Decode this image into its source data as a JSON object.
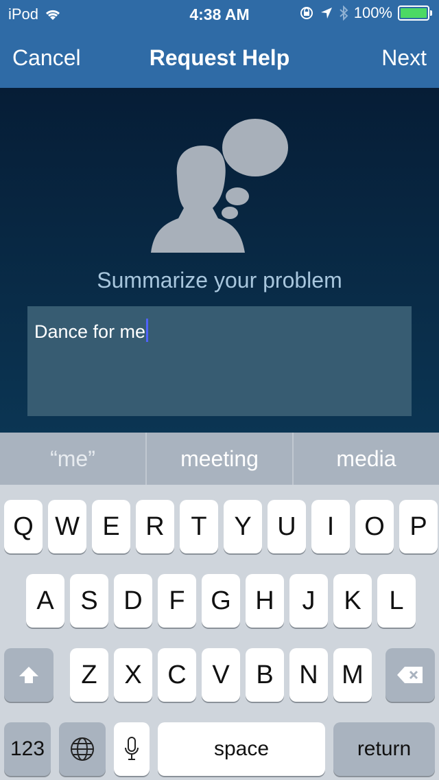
{
  "status_bar": {
    "carrier": "iPod",
    "time": "4:38 AM",
    "battery": "100%",
    "battery_level": 1.0
  },
  "nav": {
    "cancel": "Cancel",
    "title": "Request Help",
    "next": "Next"
  },
  "content": {
    "prompt": "Summarize your problem",
    "text_value": "Dance for me"
  },
  "keyboard": {
    "suggestions": [
      "“me”",
      "meeting",
      "media"
    ],
    "row1": [
      "Q",
      "W",
      "E",
      "R",
      "T",
      "Y",
      "U",
      "I",
      "O",
      "P"
    ],
    "row2": [
      "A",
      "S",
      "D",
      "F",
      "G",
      "H",
      "J",
      "K",
      "L"
    ],
    "row3": [
      "Z",
      "X",
      "C",
      "V",
      "B",
      "N",
      "M"
    ],
    "numbers_label": "123",
    "space_label": "space",
    "return_label": "return"
  }
}
